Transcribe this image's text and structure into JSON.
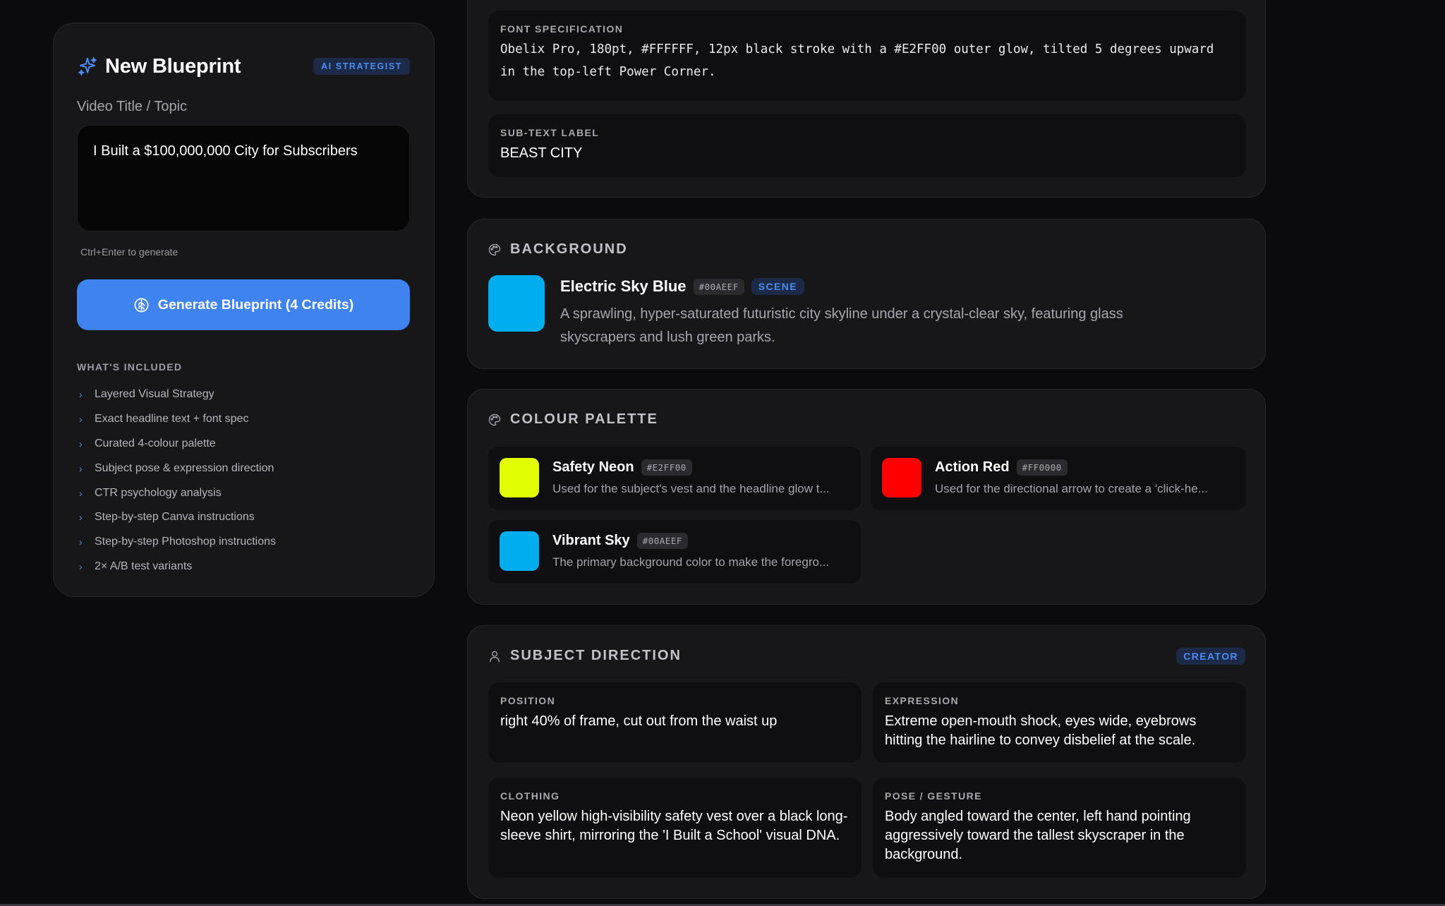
{
  "blueprint": {
    "title": "New Blueprint",
    "badge": "AI STRATEGIST",
    "field_label": "Video Title / Topic",
    "topic_value": "I Built a $100,000,000 City for Subscribers",
    "hint": "Ctrl+Enter to generate",
    "generate_label": "Generate Blueprint (4 Credits)",
    "included_heading": "WHAT'S INCLUDED",
    "included_items": [
      "Layered Visual Strategy",
      "Exact headline text + font spec",
      "Curated 4-colour palette",
      "Subject pose & expression direction",
      "CTR psychology analysis",
      "Step-by-step Canva instructions",
      "Step-by-step Photoshop instructions",
      "2× A/B test variants"
    ]
  },
  "headline": {
    "font_spec_label": "FONT SPECIFICATION",
    "font_spec_value": "Obelix Pro, 180pt, #FFFFFF, 12px black stroke with a #E2FF00 outer glow, tilted 5 degrees upward in the top-left Power Corner.",
    "subtext_label": "SUB-TEXT LABEL",
    "subtext_value": "BEAST CITY"
  },
  "background": {
    "heading": "BACKGROUND",
    "name": "Electric Sky Blue",
    "hex": "#00AEEF",
    "tag": "SCENE",
    "color": "#00AEEF",
    "description": "A sprawling, hyper-saturated futuristic city skyline under a crystal-clear sky, featuring glass skyscrapers and lush green parks."
  },
  "palette": {
    "heading": "COLOUR PALETTE",
    "colors": [
      {
        "name": "Safety Neon",
        "hex": "#E2FF00",
        "color": "#E2FF00",
        "description": "Used for the subject's vest and the headline glow t..."
      },
      {
        "name": "Action Red",
        "hex": "#FF0000",
        "color": "#FF0000",
        "description": "Used for the directional arrow to create a 'click-he..."
      },
      {
        "name": "Vibrant Sky",
        "hex": "#00AEEF",
        "color": "#00AEEF",
        "description": "The primary background color to make the foregro..."
      }
    ]
  },
  "subject": {
    "heading": "SUBJECT DIRECTION",
    "tag": "CREATOR",
    "position_label": "POSITION",
    "position_value": "right 40% of frame, cut out from the waist up",
    "expression_label": "EXPRESSION",
    "expression_value": "Extreme open-mouth shock, eyes wide, eyebrows hitting the hairline to convey disbelief at the scale.",
    "clothing_label": "CLOTHING",
    "clothing_value": "Neon yellow high-visibility safety vest over a black long-sleeve shirt, mirroring the 'I Built a School' visual DNA.",
    "pose_label": "POSE / GESTURE",
    "pose_value": "Body angled toward the center, left hand pointing aggressively toward the tallest skyscraper in the background."
  },
  "theme": {
    "accent": "#3E83F0",
    "page_bg": "#0B0B0D",
    "card_bg": "#17171A",
    "inner_bg": "#0F0F11"
  }
}
